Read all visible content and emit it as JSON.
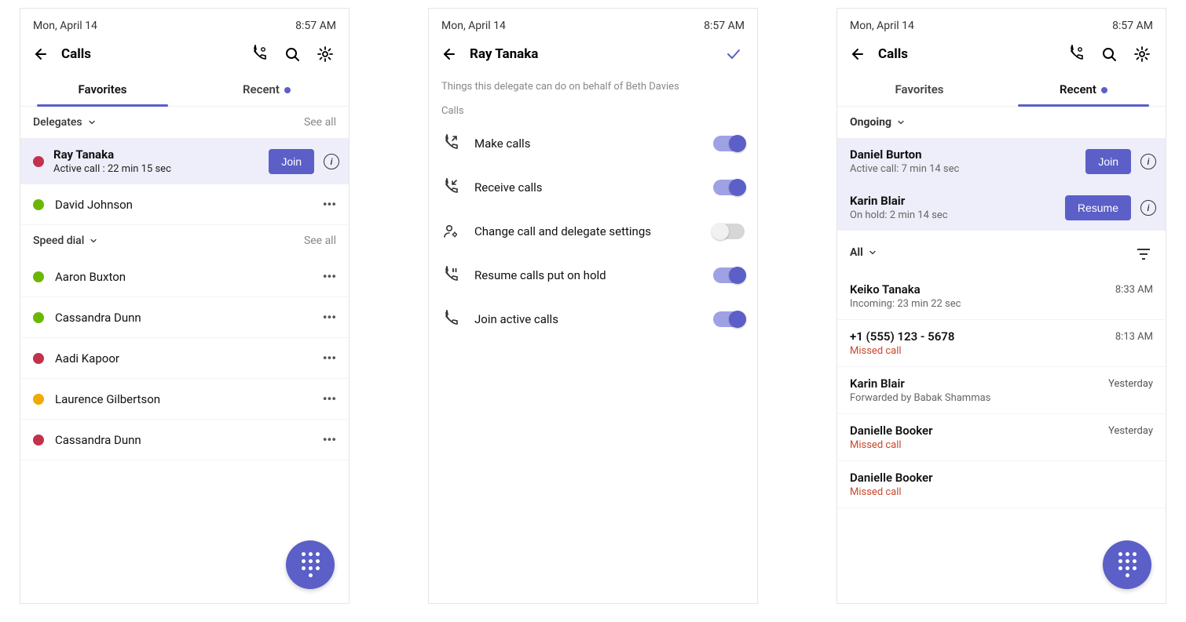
{
  "status": {
    "date": "Mon, April 14",
    "time": "8:57 AM"
  },
  "screen1": {
    "title": "Calls",
    "tabs": {
      "fav": "Favorites",
      "recent": "Recent"
    },
    "sections": {
      "delegates": {
        "label": "Delegates",
        "see_all": "See all"
      },
      "speed": {
        "label": "Speed dial",
        "see_all": "See all"
      }
    },
    "activeCall": {
      "name": "Ray Tanaka",
      "sub": "Active call : 22 min 15 sec",
      "btn": "Join"
    },
    "delegateContacts": [
      {
        "name": "David Johnson",
        "presence": "avail"
      }
    ],
    "speedDial": [
      {
        "name": "Aaron Buxton",
        "presence": "avail"
      },
      {
        "name": "Cassandra Dunn",
        "presence": "avail"
      },
      {
        "name": "Aadi Kapoor",
        "presence": "busy"
      },
      {
        "name": "Laurence Gilbertson",
        "presence": "away"
      },
      {
        "name": "Cassandra Dunn",
        "presence": "dnd"
      }
    ]
  },
  "screen2": {
    "title": "Ray Tanaka",
    "desc": "Things this delegate can do on behalf of Beth Davies",
    "section": "Calls",
    "perms": [
      {
        "label": "Make calls",
        "on": true
      },
      {
        "label": "Receive calls",
        "on": true
      },
      {
        "label": "Change call and delegate settings",
        "on": false
      },
      {
        "label": "Resume calls put on hold",
        "on": true
      },
      {
        "label": "Join active calls",
        "on": true
      }
    ]
  },
  "screen3": {
    "title": "Calls",
    "tabs": {
      "fav": "Favorites",
      "recent": "Recent"
    },
    "ongoingLabel": "Ongoing",
    "ongoing": [
      {
        "name": "Daniel Burton",
        "sub": "Active call: 7 min 14 sec",
        "btn": "Join"
      },
      {
        "name": "Karin Blair",
        "sub": "On hold: 2 min 14 sec",
        "btn": "Resume"
      }
    ],
    "allLabel": "All",
    "recent": [
      {
        "name": "Keiko Tanaka",
        "sub": "Incoming: 23 min 22 sec",
        "time": "8:33 AM",
        "missed": false
      },
      {
        "name": "+1 (555) 123 - 5678",
        "sub": "Missed call",
        "time": "8:13 AM",
        "missed": true
      },
      {
        "name": "Karin Blair",
        "sub": "Forwarded by Babak Shammas",
        "time": "Yesterday",
        "missed": false
      },
      {
        "name": "Danielle Booker",
        "sub": "Missed call",
        "time": "Yesterday",
        "missed": true
      },
      {
        "name": "Danielle Booker",
        "sub": "Missed call",
        "time": "",
        "missed": true
      }
    ]
  }
}
